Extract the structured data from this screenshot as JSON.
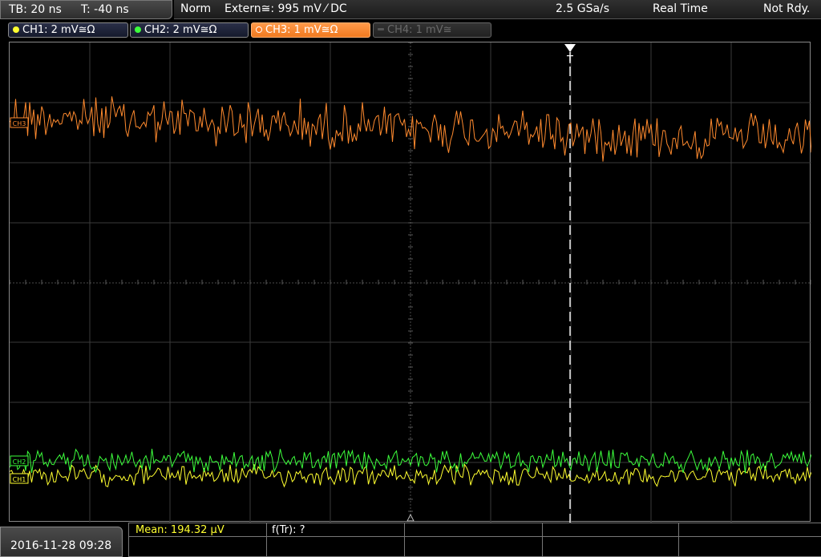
{
  "timebase": {
    "tb": "TB: 20 ns",
    "t": "T: -40 ns"
  },
  "status": {
    "mode": "Norm",
    "trigger": "Extern≅: 995 mV ⁄ DC",
    "sample_rate": "2.5 GSa/s",
    "acq_mode": "Real Time",
    "state": "Not Rdy."
  },
  "channels": [
    {
      "label": "CH1: 2 mV≅Ω",
      "color": "#ffff30",
      "active": false,
      "enabled": true
    },
    {
      "label": "CH2: 2 mV≅Ω",
      "color": "#3cff3c",
      "active": false,
      "enabled": true
    },
    {
      "label": "CH3: 1 mV≅Ω",
      "color": "#ff8a2e",
      "active": true,
      "enabled": true
    },
    {
      "label": "CH4: 1 mV≅",
      "color": "#555555",
      "active": false,
      "enabled": false
    }
  ],
  "markers": {
    "trigger": "T",
    "ch3": "CH3",
    "ch2": "CH2",
    "ch1": "CH1"
  },
  "footer": {
    "datetime": "2016-11-28 09:28",
    "mean": "Mean: 194.32 µV",
    "ftr": "f(Tr): ?"
  }
}
